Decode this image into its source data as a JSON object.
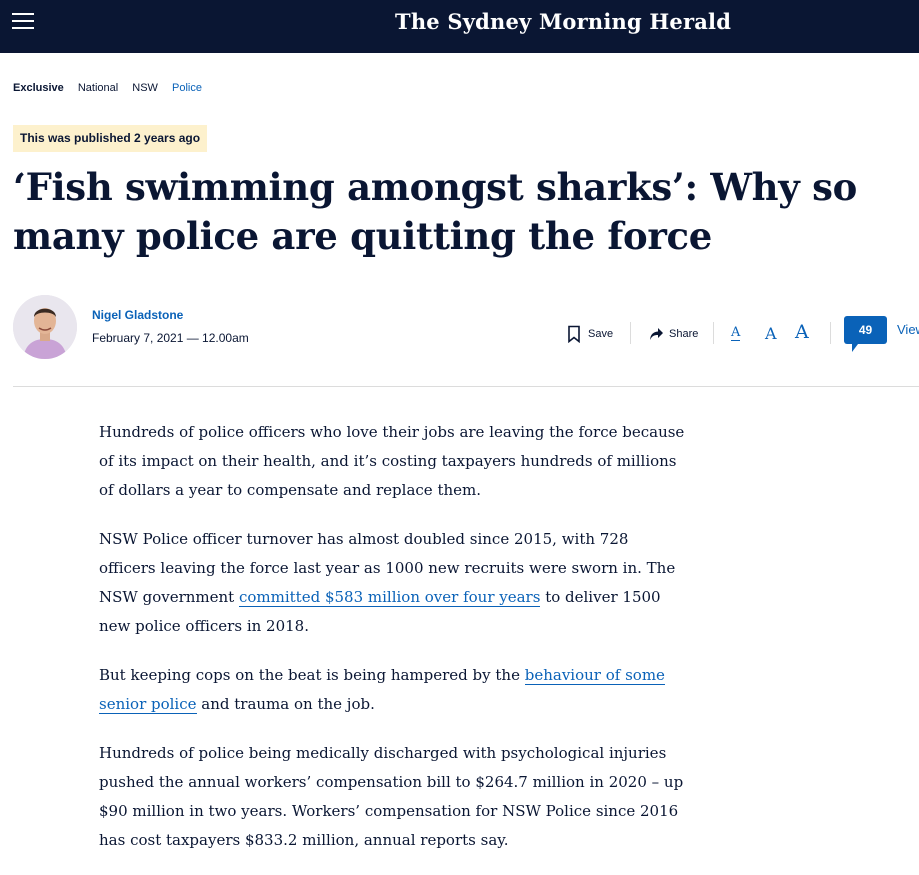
{
  "header": {
    "logo_text": "The Sydney Morning Herald",
    "background": "#0a1633"
  },
  "breadcrumbs": [
    "Exclusive",
    "National",
    "NSW",
    "Police"
  ],
  "published_badge": "This was published 2 years ago",
  "headline": "‘Fish swimming amongst sharks’: Why so many police are quitting the force",
  "byline": {
    "author": "Nigel Gladstone",
    "date": "February 7, 2021 — 12.00am"
  },
  "toolbar": {
    "save_label": "Save",
    "share_label": "Share",
    "font_small": "A",
    "font_medium": "A",
    "font_large": "A",
    "comment_count": "49",
    "view_label": "View"
  },
  "article": {
    "p1": "Hundreds of police officers who love their jobs are leaving the force because of its impact on their health, and it’s costing taxpayers hundreds of millions of dollars a year to compensate and replace them.",
    "p2_pre": "NSW Police officer turnover has almost doubled since 2015, with 728 officers leaving the force last year as 1000 new recruits were sworn in. The NSW government ",
    "p2_link": "committed $583 million over four years",
    "p2_post": " to deliver 1500 new police officers in 2018.",
    "p3_pre": "But keeping cops on the beat is being hampered by the ",
    "p3_link": "behaviour of some senior police",
    "p3_post": " and trauma on the job.",
    "p4": "Hundreds of police being medically discharged with psychological injuries pushed the annual workers’ compensation bill to $264.7 million in 2020 – up $90 million in two years. Workers’ compensation for NSW Police since 2016 has cost taxpayers $833.2 million, annual reports say."
  },
  "colors": {
    "brand_navy": "#0a1633",
    "link_blue": "#0a62b8",
    "badge_bg": "#fdf1cd"
  }
}
